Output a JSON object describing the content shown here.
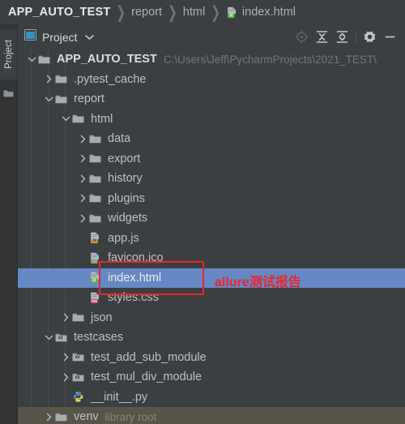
{
  "breadcrumb": {
    "items": [
      {
        "label": "APP_AUTO_TEST",
        "icon": null,
        "root": true
      },
      {
        "label": "report",
        "icon": null,
        "root": false
      },
      {
        "label": "html",
        "icon": null,
        "root": false
      },
      {
        "label": "index.html",
        "icon": "html-file-icon",
        "root": false
      }
    ],
    "separator": "❯"
  },
  "tool_strip": {
    "tab_label": "Project",
    "tab_icon": "project-tab-icon",
    "folder_icon": "folder-icon"
  },
  "panel": {
    "title": "Project",
    "window_icon": "project-window-icon",
    "caret_icon": "chevron-down-icon",
    "toolbar": [
      {
        "name": "locate-in-tree-icon",
        "title": "Select Opened File"
      },
      {
        "name": "expand-all-icon",
        "title": "Expand All"
      },
      {
        "name": "collapse-all-icon",
        "title": "Collapse All"
      },
      {
        "name": "settings-gear-icon",
        "title": "Settings"
      },
      {
        "name": "hide-panel-icon",
        "title": "Hide"
      }
    ]
  },
  "tree": {
    "rows": [
      {
        "depth": 0,
        "arrow": "expanded",
        "icon": "folder-icon",
        "label": "APP_AUTO_TEST",
        "bold": true,
        "sub": "C:\\Users\\Jeff\\PycharmProjects\\2021_TEST\\",
        "state": "normal"
      },
      {
        "depth": 1,
        "arrow": "collapsed",
        "icon": "folder-icon",
        "label": ".pytest_cache",
        "bold": false,
        "sub": "",
        "state": "normal"
      },
      {
        "depth": 1,
        "arrow": "expanded",
        "icon": "folder-icon",
        "label": "report",
        "bold": false,
        "sub": "",
        "state": "normal"
      },
      {
        "depth": 2,
        "arrow": "expanded",
        "icon": "folder-icon",
        "label": "html",
        "bold": false,
        "sub": "",
        "state": "normal"
      },
      {
        "depth": 3,
        "arrow": "collapsed",
        "icon": "folder-icon",
        "label": "data",
        "bold": false,
        "sub": "",
        "state": "normal"
      },
      {
        "depth": 3,
        "arrow": "collapsed",
        "icon": "folder-icon",
        "label": "export",
        "bold": false,
        "sub": "",
        "state": "normal"
      },
      {
        "depth": 3,
        "arrow": "collapsed",
        "icon": "folder-icon",
        "label": "history",
        "bold": false,
        "sub": "",
        "state": "normal"
      },
      {
        "depth": 3,
        "arrow": "collapsed",
        "icon": "folder-icon",
        "label": "plugins",
        "bold": false,
        "sub": "",
        "state": "normal"
      },
      {
        "depth": 3,
        "arrow": "collapsed",
        "icon": "folder-icon",
        "label": "widgets",
        "bold": false,
        "sub": "",
        "state": "normal"
      },
      {
        "depth": 3,
        "arrow": "none",
        "icon": "js-file-icon",
        "label": "app.js",
        "bold": false,
        "sub": "",
        "state": "normal"
      },
      {
        "depth": 3,
        "arrow": "none",
        "icon": "ico-file-icon",
        "label": "favicon.ico",
        "bold": false,
        "sub": "",
        "state": "normal"
      },
      {
        "depth": 3,
        "arrow": "none",
        "icon": "html-file-icon",
        "label": "index.html",
        "bold": false,
        "sub": "",
        "state": "selected"
      },
      {
        "depth": 3,
        "arrow": "none",
        "icon": "css-file-icon",
        "label": "styles.css",
        "bold": false,
        "sub": "",
        "state": "normal"
      },
      {
        "depth": 2,
        "arrow": "collapsed",
        "icon": "folder-icon",
        "label": "json",
        "bold": false,
        "sub": "",
        "state": "normal"
      },
      {
        "depth": 1,
        "arrow": "expanded",
        "icon": "source-folder-icon",
        "label": "testcases",
        "bold": false,
        "sub": "",
        "state": "normal"
      },
      {
        "depth": 2,
        "arrow": "collapsed",
        "icon": "source-folder-icon",
        "label": "test_add_sub_module",
        "bold": false,
        "sub": "",
        "state": "normal"
      },
      {
        "depth": 2,
        "arrow": "collapsed",
        "icon": "source-folder-icon",
        "label": "test_mul_div_module",
        "bold": false,
        "sub": "",
        "state": "normal"
      },
      {
        "depth": 2,
        "arrow": "none",
        "icon": "python-file-icon",
        "label": "__init__.py",
        "bold": false,
        "sub": "",
        "state": "normal"
      },
      {
        "depth": 1,
        "arrow": "collapsed",
        "icon": "folder-icon",
        "label": "venv",
        "bold": false,
        "sub": "library root",
        "state": "hovered"
      }
    ]
  },
  "annotation": {
    "text": "allure测试报告",
    "color": "#e8272c",
    "box_target_row": "index.html"
  }
}
